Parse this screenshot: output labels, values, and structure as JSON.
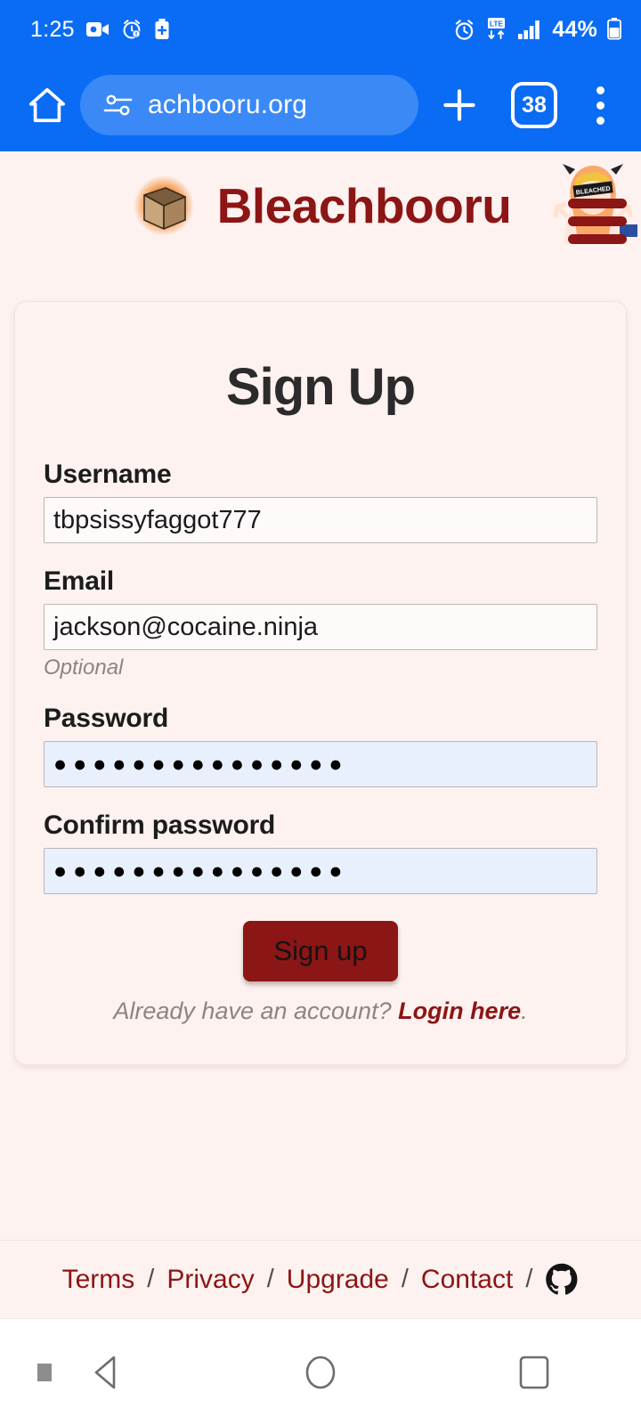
{
  "status_bar": {
    "time": "1:25",
    "left_icons": [
      "video-camera-icon",
      "alarm-warning-icon",
      "battery-saver-icon"
    ],
    "right_icons": [
      "alarm-clock-icon",
      "lte-data-icon",
      "signal-bars-icon"
    ],
    "battery_percent": "44%",
    "network_label": "LTE"
  },
  "browser": {
    "home_icon": "home-icon",
    "site_settings_icon": "site-settings-icon",
    "url": "achbooru.org",
    "new_tab_icon": "plus-icon",
    "tab_count": "38",
    "menu_icon": "kebab-menu-icon",
    "bar_color": "#0a6cf5"
  },
  "site": {
    "brand_name": "Bleachbooru",
    "brand_color": "#8c1515",
    "logo_icon": "box-logo-icon",
    "avatar_menu_icon": "avatar-hamburger-menu-icon",
    "background_color": "#fdf2f0"
  },
  "form": {
    "title": "Sign Up",
    "fields": [
      {
        "label": "Username",
        "value": "tbpsissyfaggot777",
        "placeholder": "",
        "type": "text",
        "hint": "",
        "autofilled": false
      },
      {
        "label": "Email",
        "value": "jackson@cocaine.ninja",
        "placeholder": "",
        "type": "text",
        "hint": "Optional",
        "autofilled": false
      },
      {
        "label": "Password",
        "value": "●●●●●●●●●●●●●●●",
        "placeholder": "",
        "type": "password",
        "hint": "",
        "autofilled": true
      },
      {
        "label": "Confirm password",
        "value": "●●●●●●●●●●●●●●●",
        "placeholder": "",
        "type": "password",
        "hint": "",
        "autofilled": true
      }
    ],
    "submit_label": "Sign up",
    "submit_color": "#8c1515",
    "login_prompt": "Already have an account? ",
    "login_link": "Login here",
    "login_suffix": "."
  },
  "footer": {
    "links": [
      "Terms",
      "Privacy",
      "Upgrade",
      "Contact"
    ],
    "separator": "/",
    "github_icon": "github-icon"
  },
  "navigation_bar": {
    "back_icon": "back-triangle-icon",
    "home_icon": "home-circle-icon",
    "recents_icon": "recents-square-icon",
    "indicator_icon": "small-square-indicator-icon"
  }
}
